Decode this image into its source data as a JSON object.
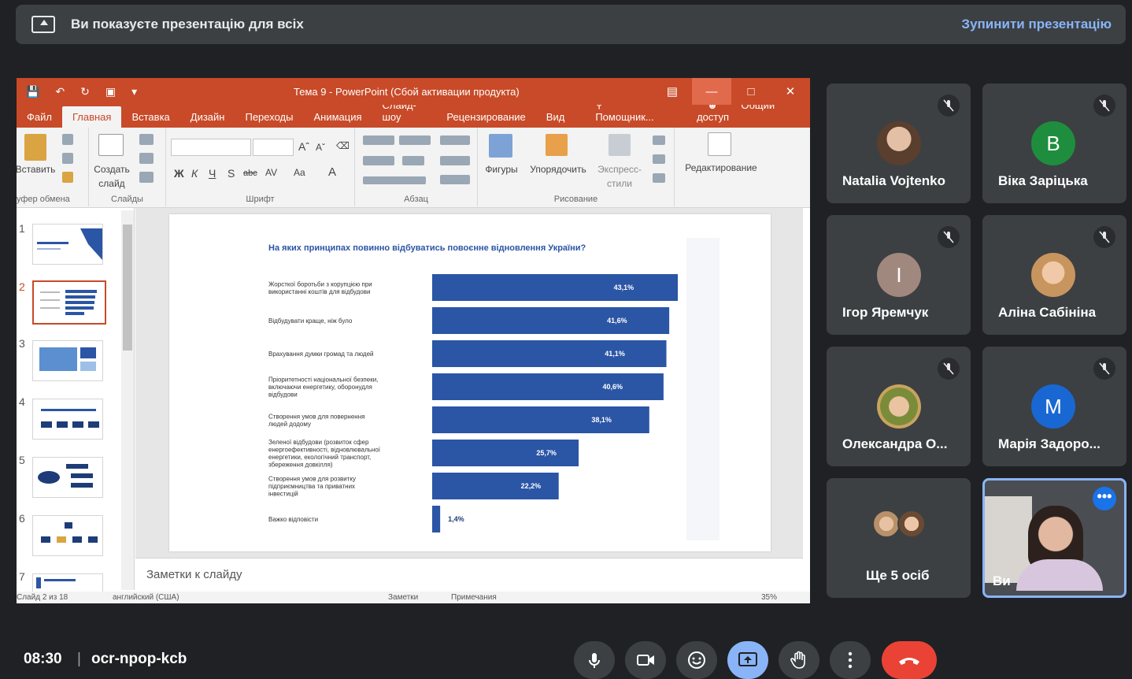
{
  "banner": {
    "message": "Ви показуєте презентацію для всіх",
    "stop_label": "Зупинити презентацію"
  },
  "ppt": {
    "title": "Тема 9 - PowerPoint (Сбой активации продукта)",
    "tabs": [
      "Файл",
      "Главная",
      "Вставка",
      "Дизайн",
      "Переходы",
      "Анимация",
      "Слайд-шоу",
      "Рецензирование",
      "Вид"
    ],
    "helper": "Помощник...",
    "share": "Общий доступ",
    "ribbon": {
      "paste": "Вставить",
      "new_slide_1": "Создать",
      "new_slide_2": "слайд",
      "clipboard": "уфер обмена",
      "slides": "Слайды",
      "font": "Шрифт",
      "paragraph": "Абзац",
      "shapes": "Фигуры",
      "arrange": "Упорядочить",
      "quick_styles_1": "Экспресс-",
      "quick_styles_2": "стили",
      "drawing": "Рисование",
      "editing": "Редактирование",
      "bold": "Ж",
      "italic": "К",
      "underline": "Ч",
      "shadow": "S",
      "strike": "abc",
      "spacing": "AV",
      "case": "Aa",
      "fontcolor": "A"
    },
    "thumb_numbers": [
      "1",
      "2",
      "3",
      "4",
      "5",
      "6",
      "7"
    ],
    "notes_placeholder": "Заметки к слайду",
    "status": {
      "slide": "Слайд 2 из 18",
      "language": "английский (США)",
      "notes": "Заметки",
      "comments": "Примечания",
      "zoom": "35%"
    }
  },
  "chart_data": {
    "type": "bar",
    "orientation": "horizontal",
    "title": "На яких принципах повинно відбуватись повоєнне відновлення України?",
    "categories": [
      [
        "Жорсткої боротьби з корупцією при",
        "використанні коштів для відбудови"
      ],
      [
        "Відбудувати краще, ніж було"
      ],
      [
        "Врахування думки громад та людей"
      ],
      [
        "Пріоритетності національної безпеки,",
        "включаючи енергетику, оборонудля",
        "відбудови"
      ],
      [
        "Створення умов для повернення",
        "людей додому"
      ],
      [
        "Зеленої відбудови (розвиток сфер",
        "енергоефективності, відновлювальної",
        "енергетики, екологічний транспорт,",
        "збереження довкілля)"
      ],
      [
        "Створення умов для розвитку",
        "підприємництва та приватних",
        "інвестицій"
      ],
      [
        "Важко відповісти"
      ]
    ],
    "values": [
      43.1,
      41.6,
      41.1,
      40.6,
      38.1,
      25.7,
      22.2,
      1.4
    ],
    "labels": [
      "43,1%",
      "41,6%",
      "41,1%",
      "40,6%",
      "38,1%",
      "25,7%",
      "22,2%",
      "1,4%"
    ],
    "bar_color": "#2b55a5",
    "xlim": [
      0,
      43.1
    ]
  },
  "participants": [
    {
      "name": "Natalia Vojtenko",
      "initial": "",
      "color": "",
      "photo": true,
      "muted": true
    },
    {
      "name": "Віка Заріцька",
      "initial": "B",
      "color": "#1e8e3e",
      "photo": false,
      "muted": true
    },
    {
      "name": "Ігор Яремчук",
      "initial": "І",
      "color": "#a1887f",
      "photo": false,
      "muted": true
    },
    {
      "name": "Аліна Сабініна",
      "initial": "",
      "color": "",
      "photo": true,
      "muted": true
    },
    {
      "name": "Олександра О...",
      "initial": "",
      "color": "",
      "photo": true,
      "muted": true
    },
    {
      "name": "Марія Задоро...",
      "initial": "M",
      "color": "#1967d2",
      "photo": false,
      "muted": true
    }
  ],
  "more_tile": {
    "label": "Ще 5 осіб"
  },
  "self_tile": {
    "label": "Ви"
  },
  "bottom": {
    "time": "08:30",
    "separator": "|",
    "meeting_code": "ocr-npop-kcb"
  },
  "colors": {
    "accent": "#8ab4f8",
    "leave": "#ea4335",
    "present_active": "#8ab4f8",
    "ppt_orange": "#c84a28"
  }
}
